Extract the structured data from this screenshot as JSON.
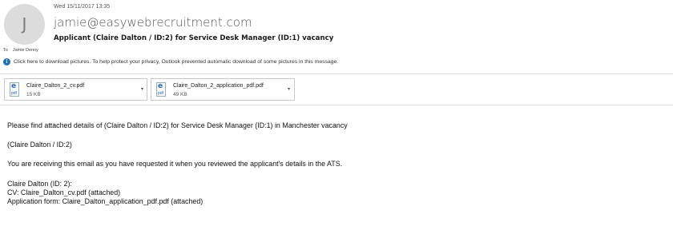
{
  "message": {
    "avatar_initial": "J",
    "date": "Wed 15/11/2017 13:35",
    "sender": "jamie@easywebrecruitment.com",
    "subject": "Applicant (Claire Dalton / ID:2) for Service Desk Manager (ID:1) vacancy",
    "to_label": "To",
    "to_name": "Jamie Denny",
    "info_bar": "Click here to download pictures. To help protect your privacy, Outlook prevented automatic download of some pictures in this message."
  },
  "attachments": [
    {
      "name": "Claire_Dalton_2_cv.pdf",
      "size": "15 KB",
      "icon": "pdf-file-icon",
      "icon_label": "pdf",
      "icon_glyph": "e"
    },
    {
      "name": "Claire_Dalton_2_application_pdf.pdf",
      "size": "49 KB",
      "icon": "pdf-file-icon",
      "icon_label": "pdf",
      "icon_glyph": "e"
    }
  ],
  "body": {
    "line1": "Please find attached details of (Claire Dalton / ID:2) for Service Desk Manager (ID:1) in Manchester vacancy",
    "line2": "(Claire Dalton / ID:2)",
    "line3": "You are receiving this email as you have requested it when you reviewed the applicant's details in the ATS.",
    "line4": "Claire Dalton (ID: 2):",
    "line5": "CV: Claire_Dalton_cv.pdf (attached)",
    "line6": "Application form: Claire_Dalton_application_pdf.pdf (attached)"
  },
  "colors": {
    "accent": "#1f6fbf",
    "avatar_bg": "#dcdcdc"
  }
}
